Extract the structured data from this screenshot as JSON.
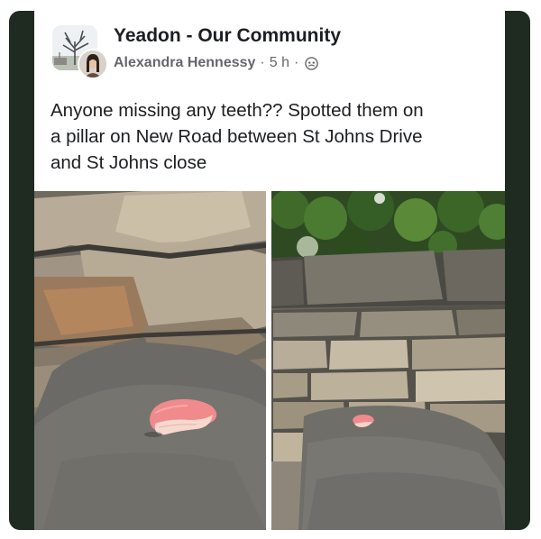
{
  "post": {
    "group_name": "Yeadon - Our Community",
    "author": "Alexandra Hennessy",
    "separator": "·",
    "time": "5 h",
    "privacy_icon": "members-icon",
    "text_lines": [
      "Anyone missing any teeth?? Spotted them on",
      "a pillar on New Road between St Johns Drive",
      "and St Johns close"
    ]
  },
  "photos": [
    {
      "subject": "dentures-closeup-photo"
    },
    {
      "subject": "dentures-on-wall-photo"
    }
  ],
  "colors": {
    "frame": "#1f2b21",
    "card": "#ffffff",
    "title_text": "#1c1e21",
    "meta_text": "#65676b",
    "denture_pink": "#f08a8c"
  }
}
